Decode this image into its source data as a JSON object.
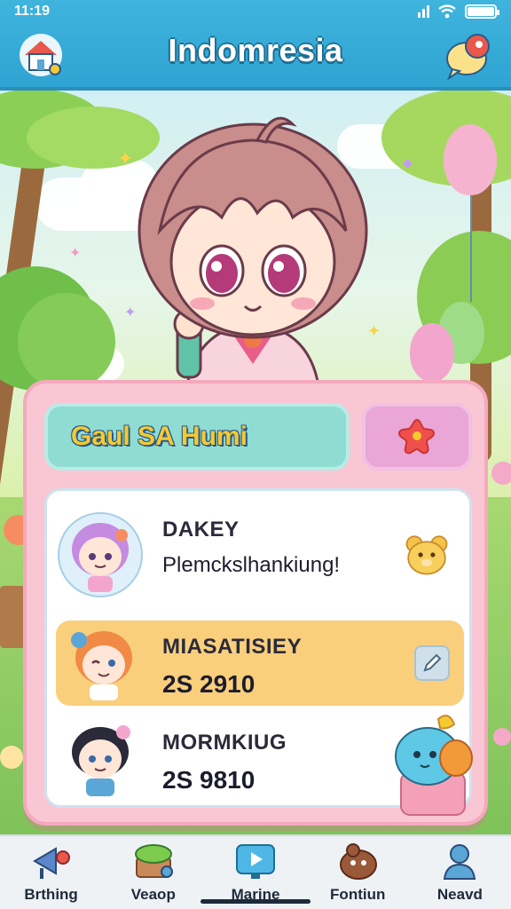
{
  "status_bar": {
    "time": "11:19"
  },
  "header": {
    "title": "Indomresia",
    "left_icon": "cottage-icon",
    "right_icon": "chat-bubble-icon"
  },
  "panel": {
    "name": "Gaul SA Humi",
    "favorite_icon": "star-icon"
  },
  "list": [
    {
      "label": "DAKEY",
      "sub": "Plemckslhankiung!",
      "action_icon": "teddy-bear-icon"
    },
    {
      "label": "MIASATISIEY",
      "sub": "2S 2910",
      "action_icon": "edit-icon"
    },
    {
      "label": "MORMKIUG",
      "sub": "2S 9810",
      "action_icon": "blue-pet-icon"
    }
  ],
  "tabs": [
    {
      "label": "Brthing",
      "icon": "megaphone-icon"
    },
    {
      "label": "Veaop",
      "icon": "garden-box-icon"
    },
    {
      "label": "Marine",
      "icon": "play-screen-icon"
    },
    {
      "label": "Fontiun",
      "icon": "brown-creature-icon"
    },
    {
      "label": "Neavd",
      "icon": "person-icon"
    }
  ],
  "colors": {
    "header": "#2fa3d2",
    "panel": "#f9c6d3",
    "name_bar": "#8fdcd3",
    "highlight_row": "#f9cf7c"
  }
}
